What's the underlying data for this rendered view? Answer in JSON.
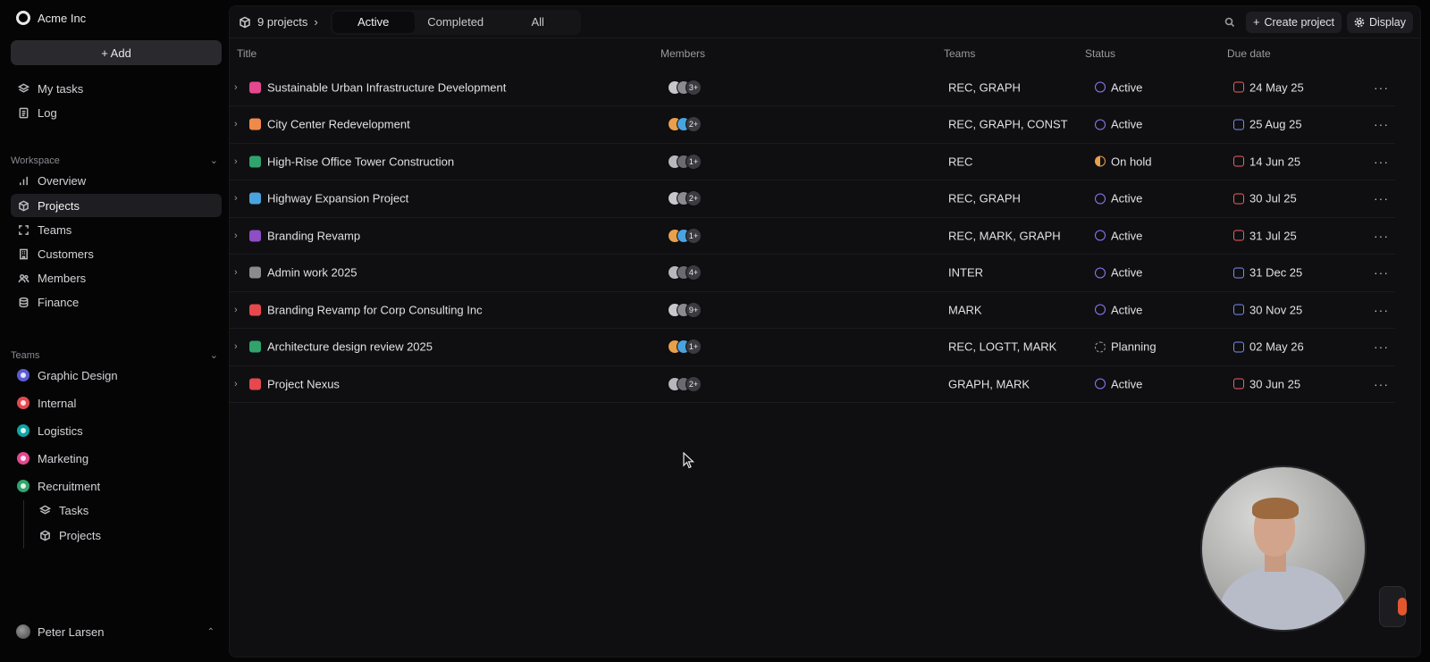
{
  "sidebar": {
    "org_name": "Acme Inc",
    "add_label": "+ Add",
    "top_items": [
      {
        "label": "My tasks",
        "icon": "stack-icon"
      },
      {
        "label": "Log",
        "icon": "document-icon"
      }
    ],
    "workspace_label": "Workspace",
    "workspace_items": [
      {
        "label": "Overview",
        "icon": "bar-chart-icon"
      },
      {
        "label": "Projects",
        "icon": "cube-icon"
      },
      {
        "label": "Teams",
        "icon": "focus-icon"
      },
      {
        "label": "Customers",
        "icon": "building-icon"
      },
      {
        "label": "Members",
        "icon": "users-icon"
      },
      {
        "label": "Finance",
        "icon": "database-icon"
      }
    ],
    "teams_label": "Teams",
    "teams": [
      {
        "label": "Graphic Design",
        "color": "#5b5bd6"
      },
      {
        "label": "Internal",
        "color": "#e5484d"
      },
      {
        "label": "Logistics",
        "color": "#0ea5a5"
      },
      {
        "label": "Marketing",
        "color": "#e5488f"
      },
      {
        "label": "Recruitment",
        "color": "#30a46c"
      }
    ],
    "sub_items": [
      {
        "label": "Tasks",
        "icon": "stack-icon"
      },
      {
        "label": "Projects",
        "icon": "cube-icon"
      }
    ],
    "user_name": "Peter Larsen"
  },
  "topbar": {
    "project_count": "9  projects",
    "tabs": [
      "Active",
      "Completed",
      "All"
    ],
    "active_tab": "Active",
    "create_label": "Create project",
    "display_label": "Display"
  },
  "table": {
    "headers": {
      "title": "Title",
      "members": "Members",
      "teams": "Teams",
      "status": "Status",
      "due": "Due date"
    },
    "rows": [
      {
        "title": "Sustainable Urban Infrastructure Development",
        "icon_color": "#e5488f",
        "member_count": "3+",
        "teams": "REC, GRAPH",
        "status": "Active",
        "status_kind": "active",
        "due": "24 May 25",
        "due_color": "red"
      },
      {
        "title": "City Center Redevelopment",
        "icon_color": "#f08a4b",
        "member_count": "2+",
        "teams": "REC, GRAPH, CONST",
        "status": "Active",
        "status_kind": "active",
        "due": "25 Aug 25",
        "due_color": "blue"
      },
      {
        "title": "High-Rise Office Tower Construction",
        "icon_color": "#30a46c",
        "member_count": "1+",
        "teams": "REC",
        "status": "On hold",
        "status_kind": "hold",
        "due": "14 Jun 25",
        "due_color": "red"
      },
      {
        "title": "Highway Expansion Project",
        "icon_color": "#4aa3df",
        "member_count": "2+",
        "teams": "REC, GRAPH",
        "status": "Active",
        "status_kind": "active",
        "due": "30 Jul 25",
        "due_color": "red"
      },
      {
        "title": "Branding Revamp",
        "icon_color": "#8e4ec6",
        "member_count": "1+",
        "teams": "REC, MARK, GRAPH",
        "status": "Active",
        "status_kind": "active",
        "due": "31 Jul 25",
        "due_color": "red"
      },
      {
        "title": "Admin work 2025",
        "icon_color": "#8a8a90",
        "member_count": "4+",
        "teams": "INTER",
        "status": "Active",
        "status_kind": "active",
        "due": "31 Dec 25",
        "due_color": "blue"
      },
      {
        "title": "Branding Revamp for Corp Consulting Inc",
        "icon_color": "#e5484d",
        "member_count": "9+",
        "teams": "MARK",
        "status": "Active",
        "status_kind": "active",
        "due": "30 Nov 25",
        "due_color": "blue"
      },
      {
        "title": "Architecture design review 2025",
        "icon_color": "#30a46c",
        "member_count": "1+",
        "teams": "REC, LOGTT, MARK",
        "status": "Planning",
        "status_kind": "plan",
        "due": "02 May 26",
        "due_color": "blue"
      },
      {
        "title": "Project Nexus",
        "icon_color": "#e5484d",
        "member_count": "2+",
        "teams": "GRAPH, MARK",
        "status": "Active",
        "status_kind": "active",
        "due": "30 Jun 25",
        "due_color": "red"
      }
    ]
  }
}
